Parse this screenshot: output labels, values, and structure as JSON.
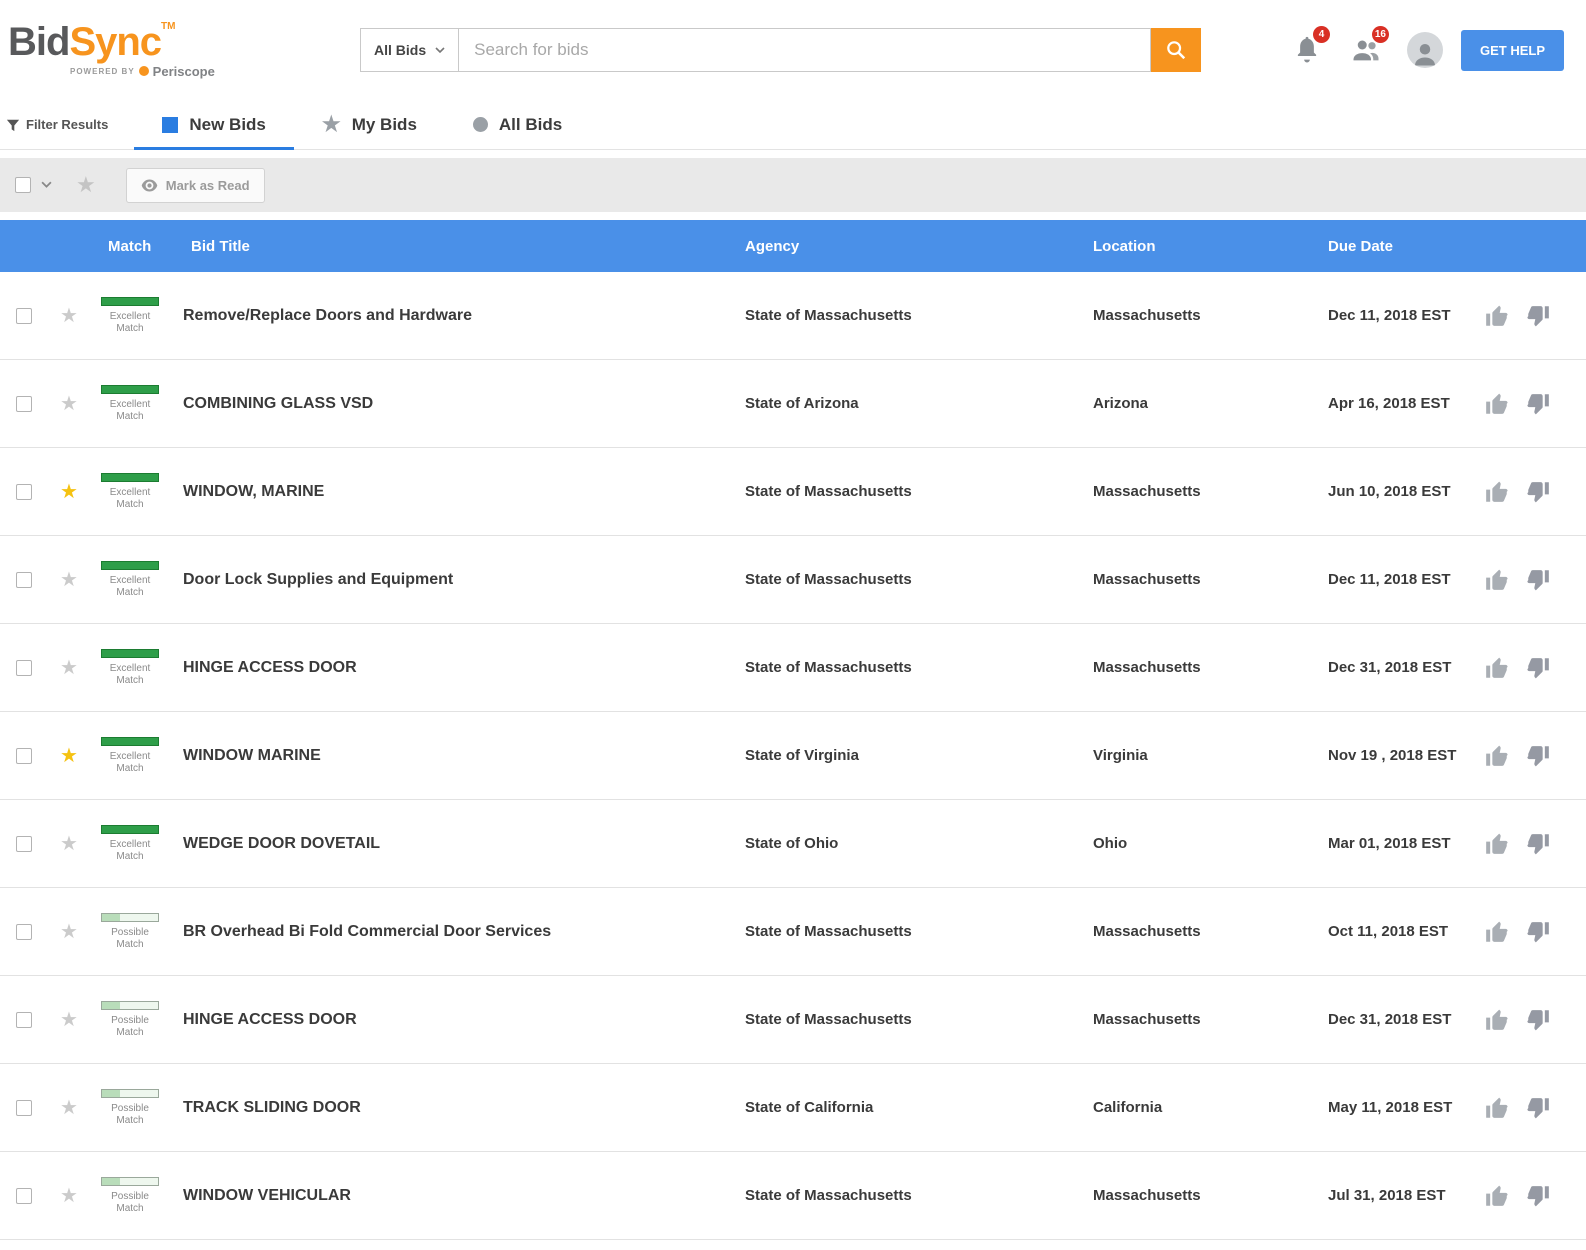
{
  "header": {
    "logo": {
      "bid": "Bid",
      "sync": "Sync",
      "tm": "TM",
      "powered_by": "POWERED BY",
      "periscope": "Periscope"
    },
    "search": {
      "scope": "All Bids",
      "placeholder": "Search for bids"
    },
    "notifications_badge": "4",
    "contacts_badge": "16",
    "get_help_label": "GET HELP"
  },
  "tabs": {
    "filter_results_label": "Filter Results",
    "items": [
      {
        "label": "New Bids",
        "active": true
      },
      {
        "label": "My Bids",
        "active": false
      },
      {
        "label": "All Bids",
        "active": false
      }
    ]
  },
  "toolbar": {
    "mark_as_read_label": "Mark as Read"
  },
  "colors": {
    "accent_orange": "#F7941E",
    "table_header_blue": "#4A90E8",
    "excellent_green": "#2E9E49",
    "badge_red": "#D93025",
    "starred_yellow": "#F5C211"
  },
  "table": {
    "headers": [
      "Match",
      "Bid Title",
      "Agency",
      "Location",
      "Due Date"
    ],
    "rows": [
      {
        "match": "Excellent Match",
        "match_level": "excellent",
        "starred": false,
        "title": "Remove/Replace Doors and Hardware",
        "agency": "State of Massachusetts",
        "location": "Massachusetts",
        "due_date": "Dec 11, 2018 EST"
      },
      {
        "match": "Excellent Match",
        "match_level": "excellent",
        "starred": false,
        "title": "COMBINING GLASS VSD",
        "agency": "State of Arizona",
        "location": "Arizona",
        "due_date": "Apr 16, 2018 EST"
      },
      {
        "match": "Excellent Match",
        "match_level": "excellent",
        "starred": true,
        "title": "WINDOW, MARINE",
        "agency": "State of Massachusetts",
        "location": "Massachusetts",
        "due_date": "Jun 10, 2018 EST"
      },
      {
        "match": "Excellent Match",
        "match_level": "excellent",
        "starred": false,
        "title": "Door Lock Supplies and Equipment",
        "agency": "State of Massachusetts",
        "location": "Massachusetts",
        "due_date": "Dec 11, 2018 EST"
      },
      {
        "match": "Excellent Match",
        "match_level": "excellent",
        "starred": false,
        "title": "HINGE ACCESS DOOR",
        "agency": "State of Massachusetts",
        "location": "Massachusetts",
        "due_date": "Dec 31, 2018 EST"
      },
      {
        "match": "Excellent Match",
        "match_level": "excellent",
        "starred": true,
        "title": "WINDOW MARINE",
        "agency": "State of Virginia",
        "location": "Virginia",
        "due_date": "Nov 19 , 2018 EST"
      },
      {
        "match": "Excellent Match",
        "match_level": "excellent",
        "starred": false,
        "title": "WEDGE DOOR DOVETAIL",
        "agency": "State of Ohio",
        "location": "Ohio",
        "due_date": "Mar 01, 2018 EST"
      },
      {
        "match": "Possible Match",
        "match_level": "possible",
        "starred": false,
        "title": "BR Overhead Bi Fold Commercial Door Services",
        "agency": "State of Massachusetts",
        "location": "Massachusetts",
        "due_date": "Oct 11, 2018 EST"
      },
      {
        "match": "Possible Match",
        "match_level": "possible",
        "starred": false,
        "title": "HINGE ACCESS DOOR",
        "agency": "State of Massachusetts",
        "location": "Massachusetts",
        "due_date": "Dec 31, 2018 EST"
      },
      {
        "match": "Possible Match",
        "match_level": "possible",
        "starred": false,
        "title": "TRACK SLIDING DOOR",
        "agency": "State of California",
        "location": "California",
        "due_date": "May 11, 2018 EST"
      },
      {
        "match": "Possible Match",
        "match_level": "possible",
        "starred": false,
        "title": "WINDOW VEHICULAR",
        "agency": "State of Massachusetts",
        "location": "Massachusetts",
        "due_date": "Jul 31, 2018 EST"
      }
    ]
  }
}
